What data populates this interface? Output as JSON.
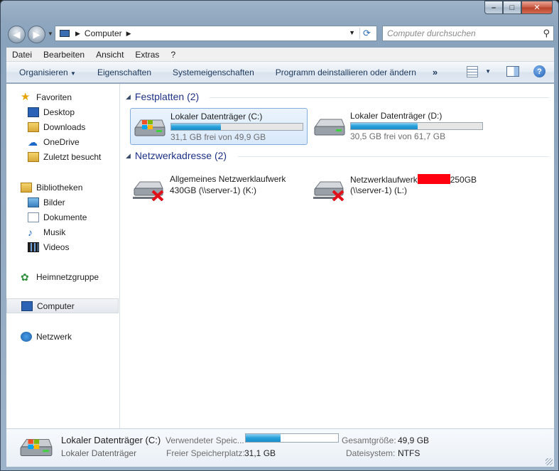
{
  "window": {
    "address": {
      "crumb": "Computer"
    },
    "search": {
      "placeholder": "Computer durchsuchen"
    }
  },
  "menubar": [
    {
      "label": "Datei"
    },
    {
      "label": "Bearbeiten"
    },
    {
      "label": "Ansicht"
    },
    {
      "label": "Extras"
    },
    {
      "label": "?"
    }
  ],
  "toolbar": {
    "organize": "Organisieren",
    "properties": "Eigenschaften",
    "system_properties": "Systemeigenschaften",
    "uninstall": "Programm deinstallieren oder ändern",
    "more": "»"
  },
  "sidebar": {
    "favorites": {
      "label": "Favoriten",
      "items": [
        {
          "label": "Desktop",
          "icon": "desktop-icon"
        },
        {
          "label": "Downloads",
          "icon": "downloads-folder-icon"
        },
        {
          "label": "OneDrive",
          "icon": "onedrive-cloud-icon"
        },
        {
          "label": "Zuletzt besucht",
          "icon": "recent-places-icon"
        }
      ]
    },
    "libraries": {
      "label": "Bibliotheken",
      "items": [
        {
          "label": "Bilder",
          "icon": "pictures-icon"
        },
        {
          "label": "Dokumente",
          "icon": "documents-icon"
        },
        {
          "label": "Musik",
          "icon": "music-icon"
        },
        {
          "label": "Videos",
          "icon": "videos-icon"
        }
      ]
    },
    "homegroup": {
      "label": "Heimnetzgruppe"
    },
    "computer": {
      "label": "Computer"
    },
    "network": {
      "label": "Netzwerk"
    }
  },
  "groups": {
    "hard_disks": {
      "title": "Festplatten (2)",
      "drives": [
        {
          "name": "Lokaler Datenträger (C:)",
          "free": "31,1 GB frei von 49,9 GB",
          "used_fraction": 0.377
        },
        {
          "name": "Lokaler Datenträger (D:)",
          "free": "30,5 GB frei von 61,7 GB",
          "used_fraction": 0.506
        }
      ]
    },
    "network_locations": {
      "title": "Netzwerkadresse (2)",
      "drives": [
        {
          "line1": "Allgemeines Netzwerklaufwerk",
          "line2": "430GB (\\\\server-1) (K:)"
        },
        {
          "line1_a": "Netzwerklaufwerk",
          "line1_b": "250GB",
          "line2": "(\\\\server-1) (L:)"
        }
      ]
    }
  },
  "details": {
    "title": "Lokaler Datenträger (C:)",
    "subtitle": "Lokaler Datenträger",
    "used_label": "Verwendeter Speic...",
    "used_fraction": 0.377,
    "free_label": "Freier Speicherplatz:",
    "free_value": "31,1 GB",
    "total_label": "Gesamtgröße:",
    "total_value": "49,9 GB",
    "fs_label": "Dateisystem:",
    "fs_value": "NTFS"
  }
}
